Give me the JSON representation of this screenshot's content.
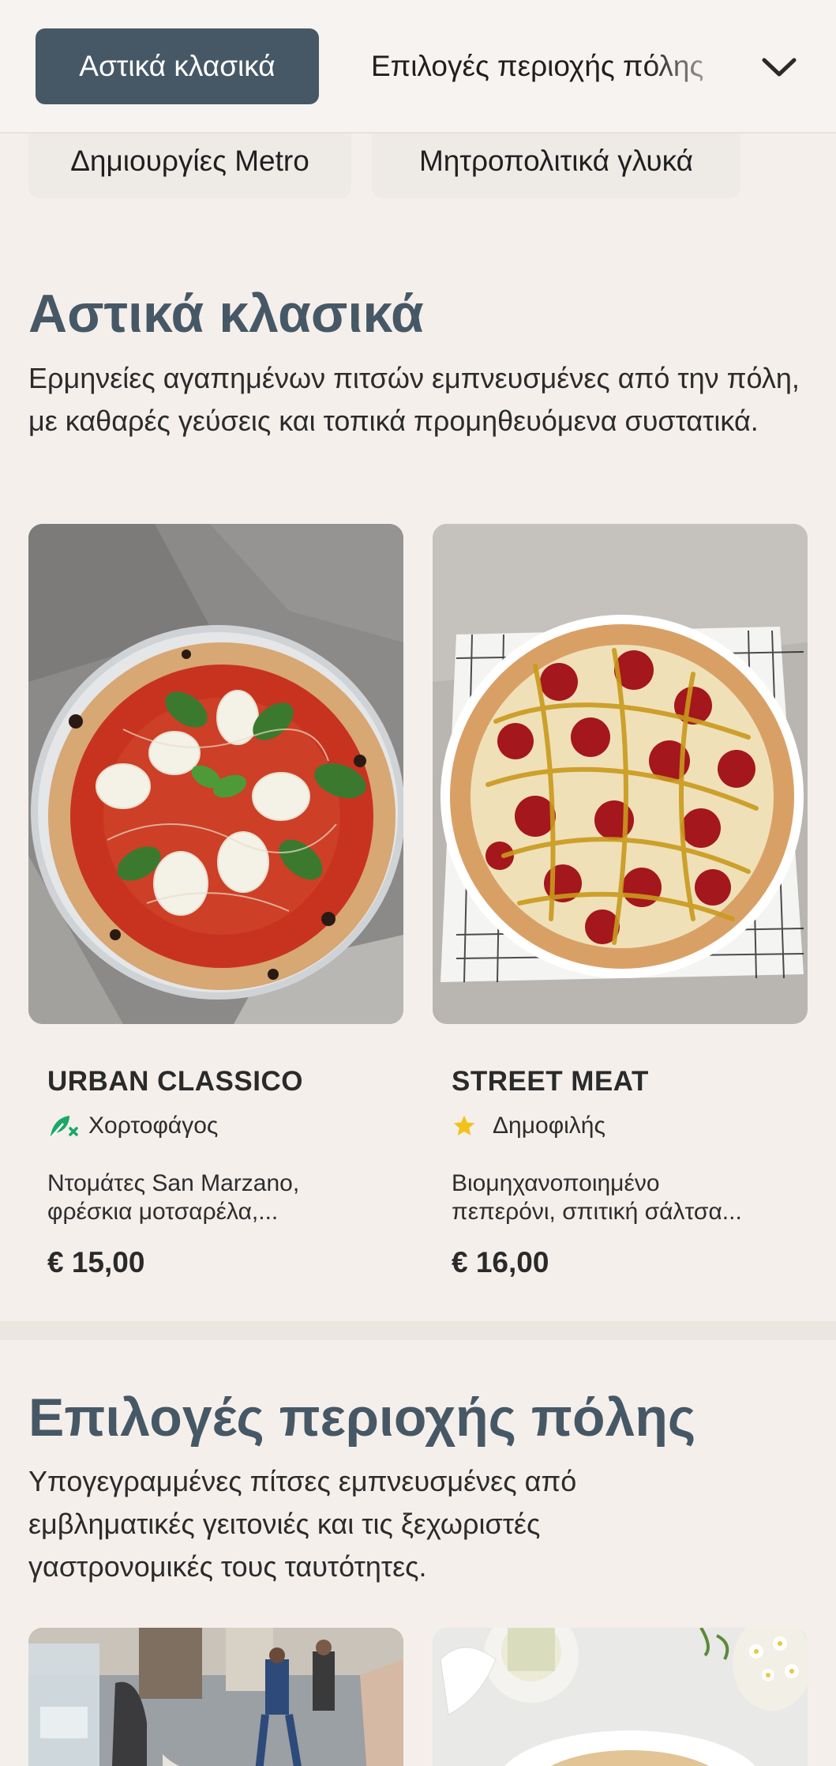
{
  "category_nav": {
    "active": "Αστικά κλασικά",
    "next": "Επιλογές περιοχής πόλης",
    "row2": [
      "Δημιουργίες Metro",
      "Μητροπολιτικά γλυκά"
    ]
  },
  "sections": [
    {
      "title": "Αστικά κλασικά",
      "description": "Ερμηνείες αγαπημένων πιτσών εμπνευσμένες από την πόλη, με καθαρές γεύσεις και τοπικά προμηθευόμενα συστατικά.",
      "items": [
        {
          "name": "URBAN CLASSICO",
          "tag": "Χορτοφάγος",
          "tag_icon": "vegetarian-leaf-icon",
          "description": "Ντομάτες San Marzano, φρέσκια μοτσαρέλα,...",
          "price": "€ 15,00"
        },
        {
          "name": "STREET MEAT",
          "tag": "Δημοφιλής",
          "tag_icon": "star-icon",
          "description": "Βιομηχανοποιημένο πεπερόνι, σπιτική σάλτσα...",
          "price": "€ 16,00"
        }
      ]
    },
    {
      "title": "Επιλογές περιοχής πόλης",
      "description": "Υπογεγραμμένες πίτσες εμπνευσμένες από εμβληματικές γειτονιές και τις ξεχωριστές γαστρονομικές τους ταυτότητες."
    }
  ],
  "colors": {
    "background": "#f5efeb",
    "accent": "#465865",
    "vegetarian": "#1aa867",
    "star": "#f2c21b"
  }
}
